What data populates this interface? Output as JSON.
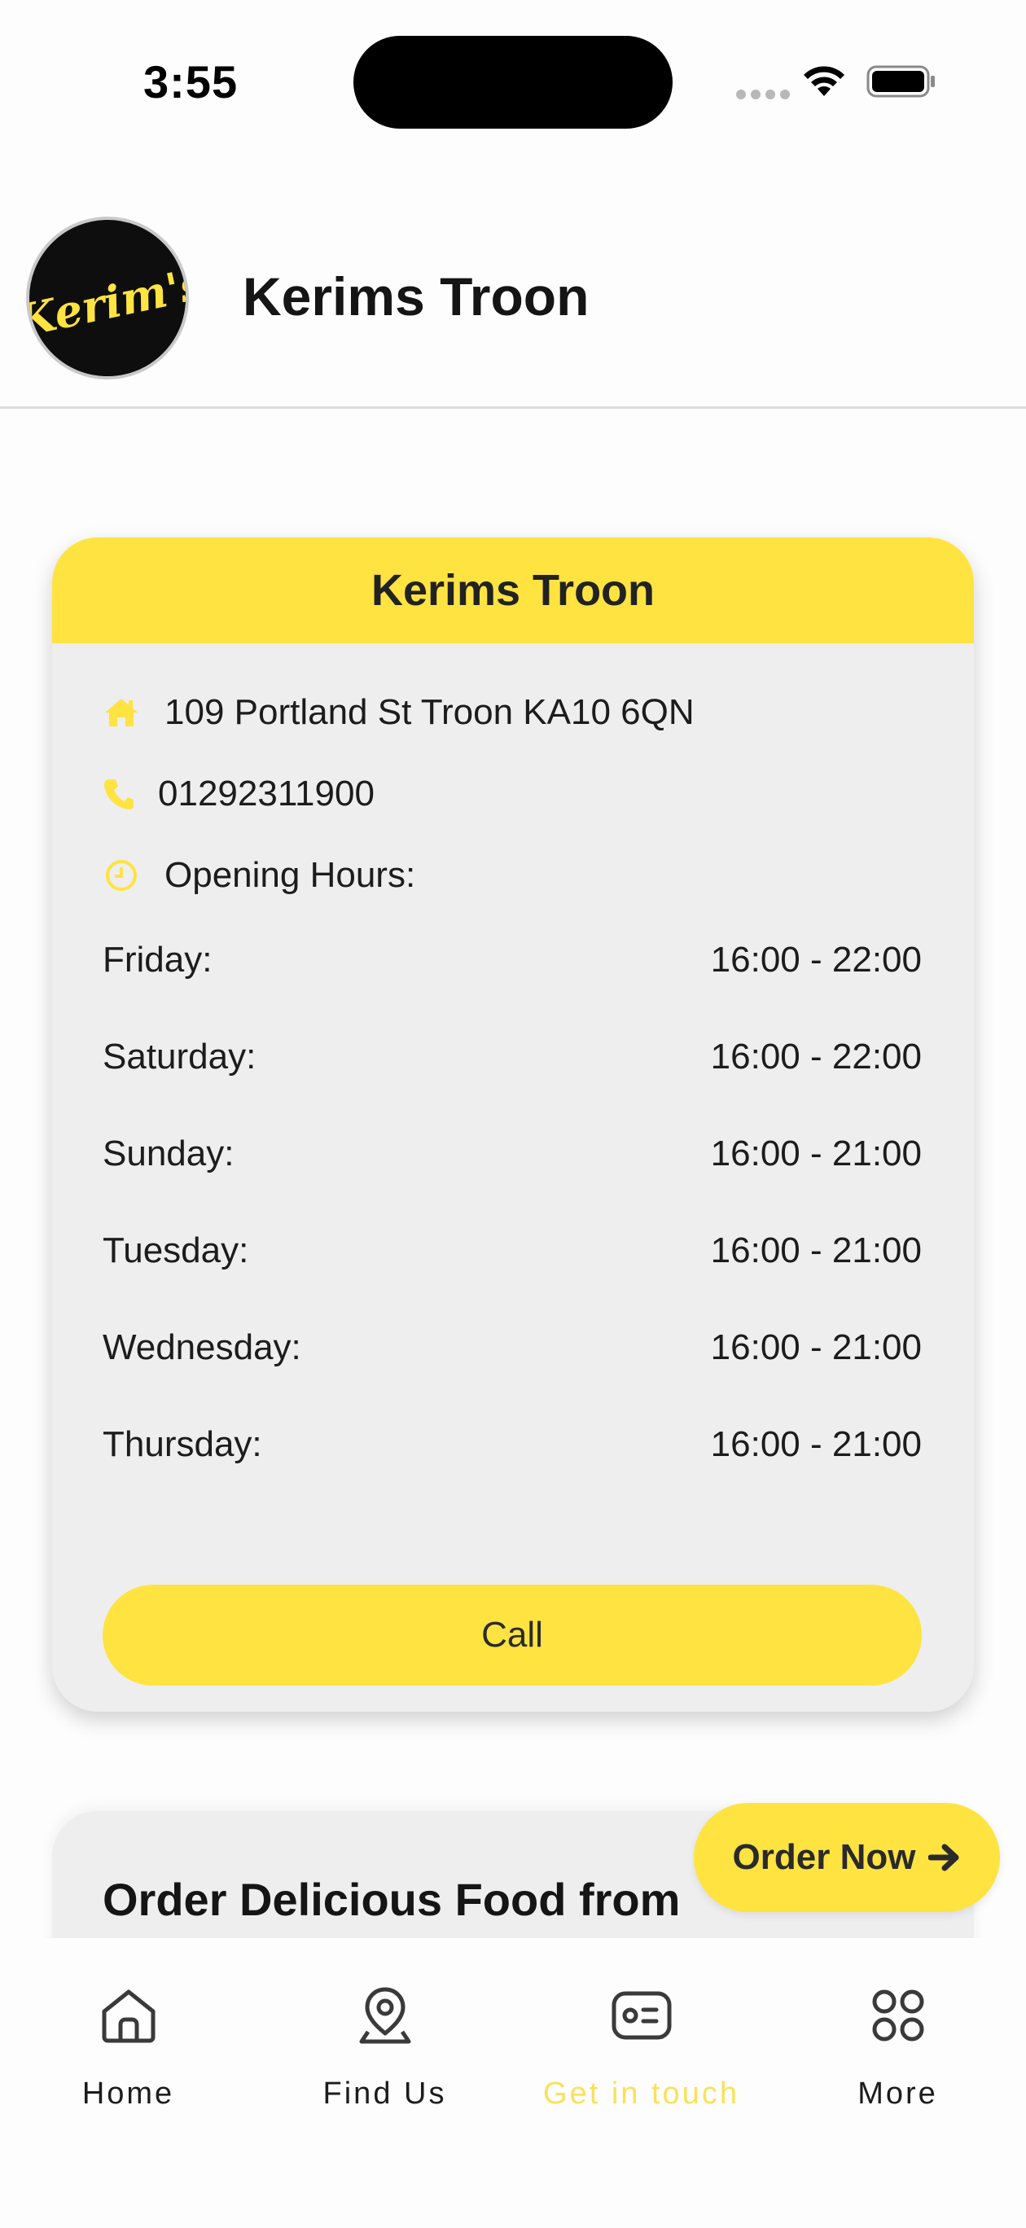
{
  "status_bar": {
    "time": "3:55"
  },
  "header": {
    "logo_text": "Kerim's",
    "title": "Kerims Troon"
  },
  "info_card": {
    "title": "Kerims Troon",
    "address": "109 Portland St Troon KA10 6QN",
    "phone": "01292311900",
    "hours_label": "Opening Hours:",
    "hours": [
      {
        "day": "Friday:",
        "time": "16:00 - 22:00"
      },
      {
        "day": "Saturday:",
        "time": "16:00 - 22:00"
      },
      {
        "day": "Sunday:",
        "time": "16:00 - 21:00"
      },
      {
        "day": "Tuesday:",
        "time": "16:00 - 21:00"
      },
      {
        "day": "Wednesday:",
        "time": "16:00 - 21:00"
      },
      {
        "day": "Thursday:",
        "time": "16:00 - 21:00"
      }
    ],
    "call_label": "Call"
  },
  "promo_card": {
    "title": "Order Delicious Food from Kerims Troon"
  },
  "order_button": {
    "label": "Order Now"
  },
  "bottom_nav": {
    "items": [
      {
        "label": "Home",
        "icon": "home-icon"
      },
      {
        "label": "Find Us",
        "icon": "map-pin-icon"
      },
      {
        "label": "Get in touch",
        "icon": "contact-card-icon",
        "active": true
      },
      {
        "label": "More",
        "icon": "grid-icon"
      }
    ]
  },
  "colors": {
    "accent": "#ffe341",
    "active_nav": "#fbe15a",
    "card_bg": "#eeeeee",
    "text": "#1c1c1c"
  }
}
